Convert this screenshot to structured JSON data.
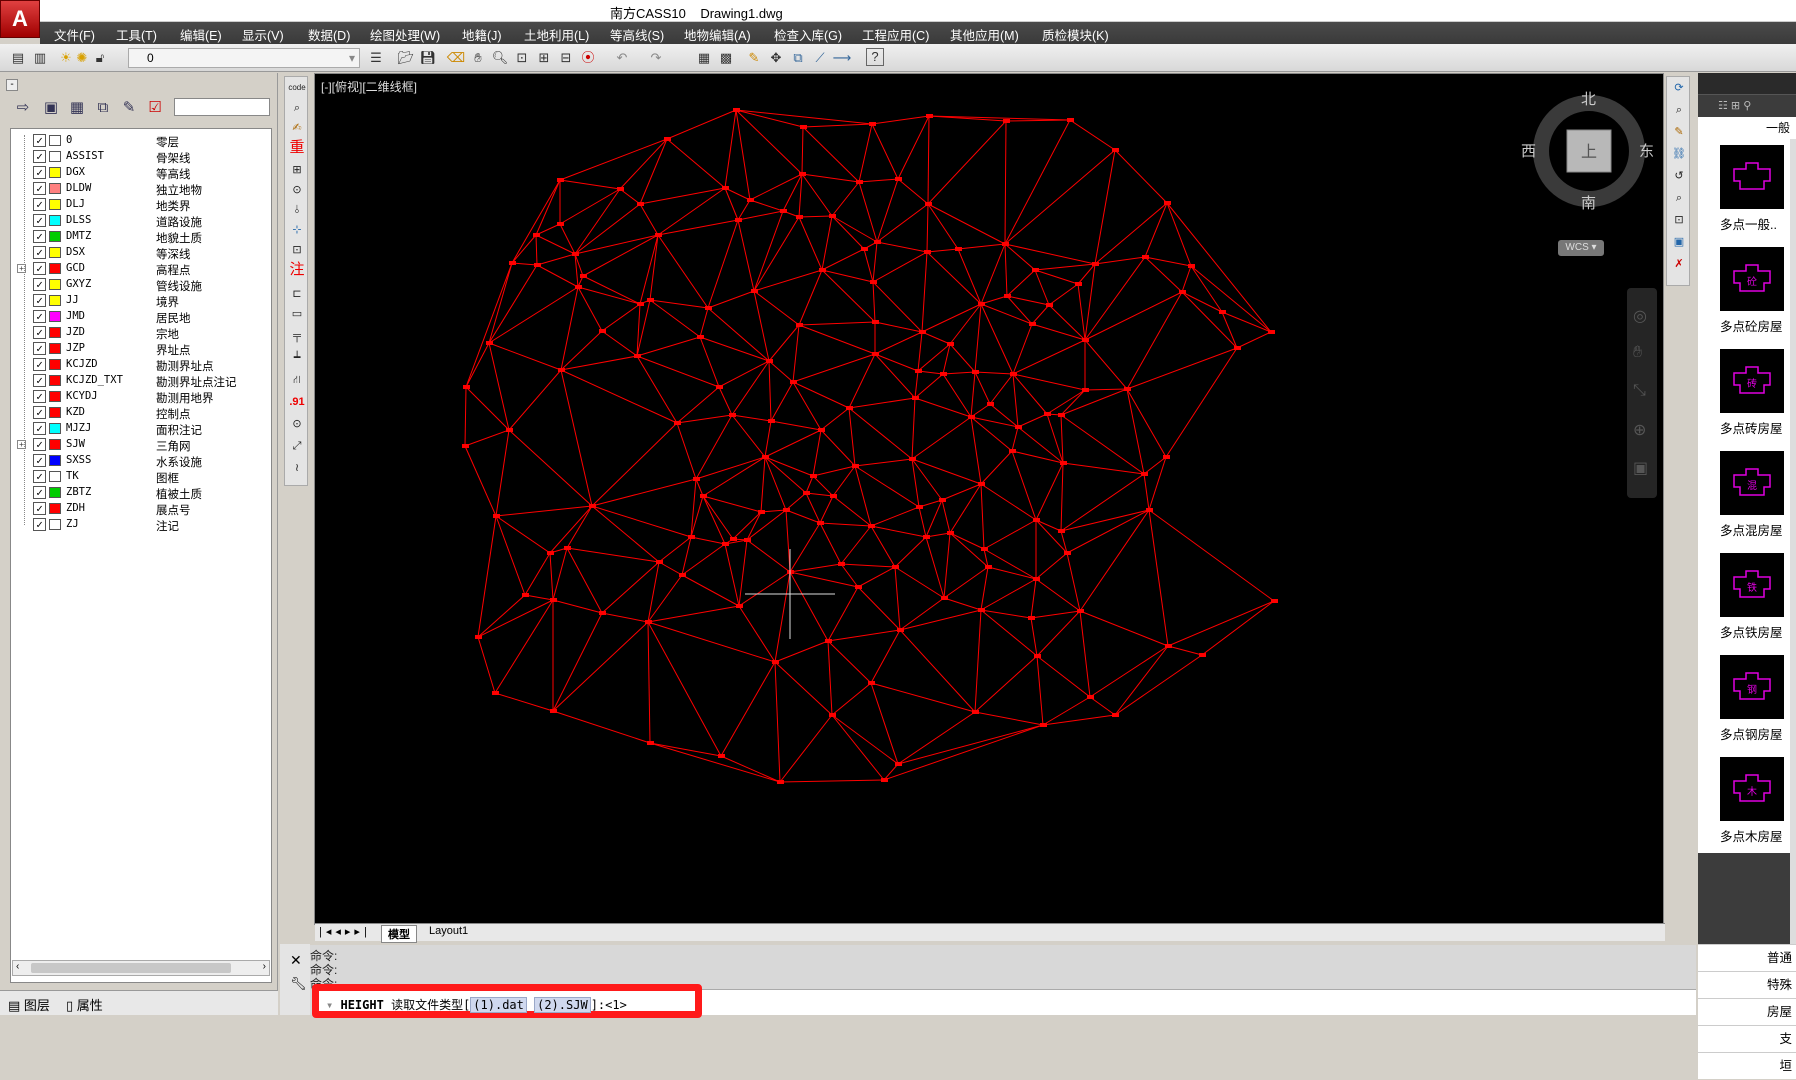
{
  "window": {
    "app_title": "南方CASS10",
    "file_title": "Drawing1.dwg",
    "logo": "A"
  },
  "menu": [
    "文件(F)",
    "工具(T)",
    "编辑(E)",
    "显示(V)",
    "数据(D)",
    "绘图处理(W)",
    "地籍(J)",
    "土地利用(L)",
    "等高线(S)",
    "地物编辑(A)",
    "检查入库(G)",
    "工程应用(C)",
    "其他应用(M)",
    "质检模块(K)"
  ],
  "toolbar": {
    "current_layer": "0"
  },
  "layer_panel": {
    "layers": [
      {
        "name": "0",
        "desc": "零层",
        "color": "#ffffff",
        "expandable": false
      },
      {
        "name": "ASSIST",
        "desc": "骨架线",
        "color": "#ffffff",
        "expandable": false
      },
      {
        "name": "DGX",
        "desc": "等高线",
        "color": "#ffff00",
        "expandable": false
      },
      {
        "name": "DLDW",
        "desc": "独立地物",
        "color": "#ff8080",
        "expandable": false
      },
      {
        "name": "DLJ",
        "desc": "地类界",
        "color": "#ffff00",
        "expandable": false
      },
      {
        "name": "DLSS",
        "desc": "道路设施",
        "color": "#00ffff",
        "expandable": false
      },
      {
        "name": "DMTZ",
        "desc": "地貌土质",
        "color": "#00cc00",
        "expandable": false
      },
      {
        "name": "DSX",
        "desc": "等深线",
        "color": "#ffff00",
        "expandable": false
      },
      {
        "name": "GCD",
        "desc": "高程点",
        "color": "#ff0000",
        "expandable": true
      },
      {
        "name": "GXYZ",
        "desc": "管线设施",
        "color": "#ffff00",
        "expandable": false
      },
      {
        "name": "JJ",
        "desc": "境界",
        "color": "#ffff00",
        "expandable": false
      },
      {
        "name": "JMD",
        "desc": "居民地",
        "color": "#ff00ff",
        "expandable": false
      },
      {
        "name": "JZD",
        "desc": "宗地",
        "color": "#ff0000",
        "expandable": false
      },
      {
        "name": "JZP",
        "desc": "界址点",
        "color": "#ff0000",
        "expandable": false
      },
      {
        "name": "KCJZD",
        "desc": "勘测界址点",
        "color": "#ff0000",
        "expandable": false
      },
      {
        "name": "KCJZD_TXT",
        "desc": "勘测界址点注记",
        "color": "#ff0000",
        "expandable": false
      },
      {
        "name": "KCYDJ",
        "desc": "勘测用地界",
        "color": "#ff0000",
        "expandable": false
      },
      {
        "name": "KZD",
        "desc": "控制点",
        "color": "#ff0000",
        "expandable": false
      },
      {
        "name": "MJZJ",
        "desc": "面积注记",
        "color": "#00ffff",
        "expandable": false
      },
      {
        "name": "SJW",
        "desc": "三角网",
        "color": "#ff0000",
        "expandable": true
      },
      {
        "name": "SXSS",
        "desc": "水系设施",
        "color": "#0000ff",
        "expandable": false
      },
      {
        "name": "TK",
        "desc": "图框",
        "color": "#ffffff",
        "expandable": false
      },
      {
        "name": "ZBTZ",
        "desc": "植被土质",
        "color": "#00cc00",
        "expandable": false
      },
      {
        "name": "ZDH",
        "desc": "展点号",
        "color": "#ff0000",
        "expandable": false
      },
      {
        "name": "ZJ",
        "desc": "注记",
        "color": "#ffffff",
        "expandable": false
      }
    ],
    "tabs": [
      "图层",
      "属性"
    ]
  },
  "vtools": [
    "code",
    "重",
    "注",
    ".91"
  ],
  "canvas": {
    "view_label": "[-][俯视][二维线框]",
    "compass": {
      "north": "北",
      "south": "南",
      "east": "东",
      "west": "西",
      "center": "上",
      "ucs": "WCS"
    },
    "tabs": [
      "模型",
      "Layout1"
    ],
    "line_color": "#ff0000"
  },
  "command": {
    "history": [
      "命令:",
      "命令:",
      "命令:"
    ],
    "prompt_cmd": "HEIGHT",
    "prompt_text": "读取文件类型[",
    "opt1": "(1).dat",
    "opt2": "(2).SJW",
    "prompt_tail": "]:<1>",
    "highlight_color": "#ff1a1a"
  },
  "right_panel": {
    "tab": "一般",
    "items": [
      "多点一般..",
      "多点砼房屋",
      "多点砖房屋",
      "多点混房屋",
      "多点铁房屋",
      "多点钢房屋",
      "多点木房屋"
    ],
    "glyphs": [
      "",
      "砼",
      "砖",
      "混",
      "铁",
      "钢",
      "木"
    ],
    "categories": [
      "普通",
      "特殊",
      "房屋",
      "支",
      "垣"
    ]
  }
}
